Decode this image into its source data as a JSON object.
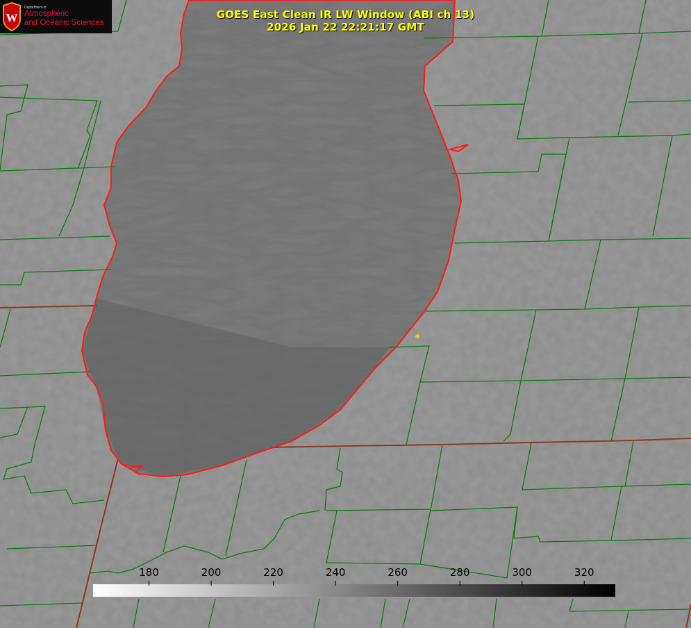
{
  "logo": {
    "dept_text": "Department of",
    "line1": "Atmospheric",
    "line2": "and Oceanic Sciences",
    "crest_letter": "W"
  },
  "title": {
    "line1": "GOES East Clean IR LW Window (ABI ch 13)",
    "line2": "2026 Jan 22 22:21:17 GMT"
  },
  "colorbar": {
    "ticks": [
      "180",
      "200",
      "220",
      "240",
      "260",
      "280",
      "300",
      "320"
    ],
    "tick_values": [
      180,
      200,
      220,
      240,
      260,
      280,
      300,
      320
    ],
    "range": [
      162,
      330
    ],
    "from_color": "#ffffff",
    "to_color": "#000000"
  },
  "colors": {
    "background": "#8a8a8a",
    "lake": "#6e6e6e",
    "county_lines": "#0b7a0b",
    "state_lines": "#8b3a1a",
    "shoreline": "#ff1a1a",
    "title_text": "#ffff00",
    "marker": "#e6c619"
  }
}
